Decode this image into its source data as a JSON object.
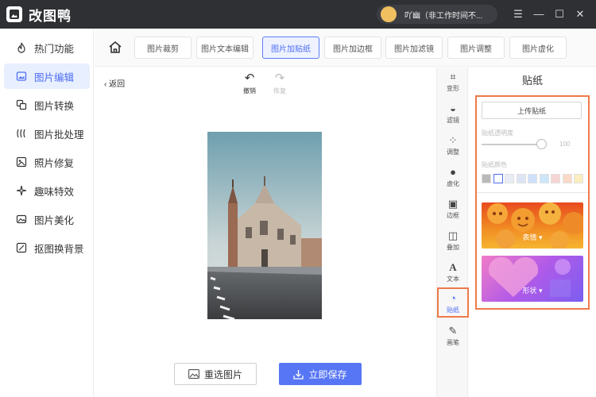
{
  "app": {
    "title": "改图鸭",
    "user": "吖幽（非工作时间不..."
  },
  "window": {
    "menu": "☰",
    "minimize": "—",
    "maximize": "☐",
    "close": "✕"
  },
  "sidebar": {
    "items": [
      {
        "label": "热门功能",
        "icon": "fire-icon"
      },
      {
        "label": "图片编辑",
        "icon": "image-edit-icon",
        "active": true
      },
      {
        "label": "图片转换",
        "icon": "convert-icon"
      },
      {
        "label": "图片批处理",
        "icon": "batch-icon"
      },
      {
        "label": "照片修复",
        "icon": "repair-icon"
      },
      {
        "label": "趣味特效",
        "icon": "sparkle-icon"
      },
      {
        "label": "图片美化",
        "icon": "beautify-icon"
      },
      {
        "label": "抠图换背景",
        "icon": "cutout-icon"
      }
    ]
  },
  "tabs": [
    {
      "label": "图片裁剪"
    },
    {
      "label": "图片文本编辑"
    },
    {
      "label": "图片加贴纸",
      "active": true
    },
    {
      "label": "图片加边框"
    },
    {
      "label": "图片加滤镜"
    },
    {
      "label": "图片调整"
    },
    {
      "label": "图片虚化"
    }
  ],
  "canvas": {
    "back": "返回",
    "undo": "撤销",
    "redo": "恢复"
  },
  "tools": [
    {
      "label": "变形",
      "icon": "crop-icon"
    },
    {
      "label": "滤镜",
      "icon": "filter-icon"
    },
    {
      "label": "调整",
      "icon": "adjust-icon"
    },
    {
      "label": "虚化",
      "icon": "blur-icon"
    },
    {
      "label": "边框",
      "icon": "border-icon"
    },
    {
      "label": "叠加",
      "icon": "overlay-icon"
    },
    {
      "label": "文本",
      "icon": "text-icon"
    },
    {
      "label": "贴纸",
      "icon": "sticker-icon",
      "active": true
    },
    {
      "label": "画笔",
      "icon": "brush-icon"
    }
  ],
  "panel": {
    "title": "贴纸",
    "upload": "上传贴纸",
    "opacity_label": "贴纸透明度",
    "opacity_value": "100",
    "color_label": "贴纸颜色",
    "swatches": [
      "#b9b9b9",
      "#ffffff",
      "#e8ecf5",
      "#dde5f4",
      "#cfe0fb",
      "#cde6f9",
      "#f8d5d5",
      "#fbd9c8",
      "#fbeec0"
    ],
    "cards": [
      {
        "label": "表情"
      },
      {
        "label": "形状"
      }
    ]
  },
  "actions": {
    "reselect": "重选图片",
    "save": "立即保存"
  },
  "colors": {
    "accent": "#4d6df3",
    "highlight": "#ee7a4a",
    "titlebar": "#2f3034"
  }
}
